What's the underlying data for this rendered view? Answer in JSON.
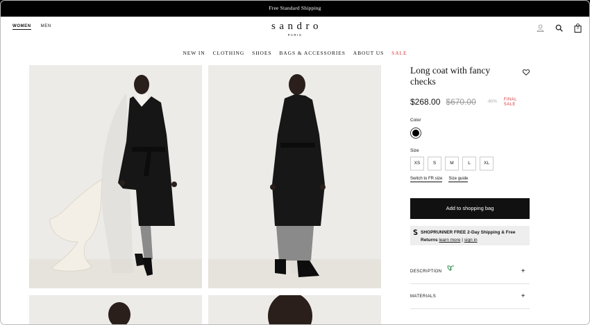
{
  "promo": {
    "text": "Free Standard Shipping"
  },
  "header": {
    "gender_tabs": [
      "WOMEN",
      "MEN"
    ],
    "logo": "sandro",
    "logo_sub": "PARIS",
    "cart_count": "0"
  },
  "nav": {
    "items": [
      "NEW IN",
      "CLOTHING",
      "SHOES",
      "BAGS & ACCESSORIES",
      "ABOUT US"
    ],
    "sale": "SALE"
  },
  "product": {
    "title": "Long coat with fancy checks",
    "price": "$268.00",
    "original_price": "$670.00",
    "discount": "-60%",
    "final_sale": "FINAL SALE",
    "color_label": "Color",
    "color_selected": "#000000",
    "size_label": "Size",
    "sizes": [
      "XS",
      "S",
      "M",
      "L",
      "XL"
    ],
    "switch_label": "Switch to FR size",
    "size_guide": "Size guide",
    "add_to_bag": "Add to shopping bag"
  },
  "shoprunner": {
    "text": "SHOPRUNNER FREE 2-Day Shipping & Free Returns",
    "learn_more": "learn more",
    "separator": "|",
    "sign_in": "sign in"
  },
  "accordion": {
    "description": "DESCRIPTION",
    "materials": "MATERIALS",
    "plus": "+"
  },
  "colors": {
    "sale": "#d33c3c",
    "button": "#111111",
    "eco_icon": "#2c8a4a"
  }
}
